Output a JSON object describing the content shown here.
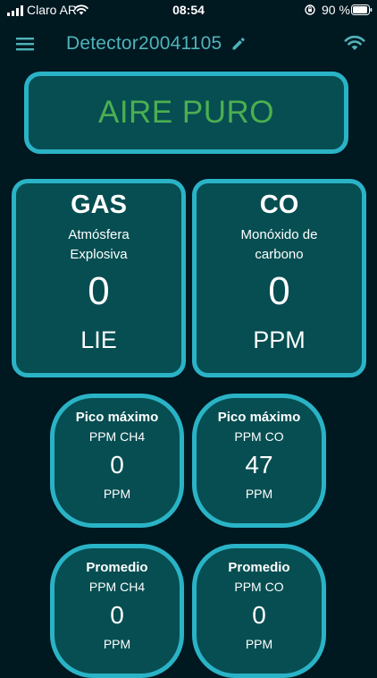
{
  "status_bar": {
    "carrier": "Claro AR",
    "time": "08:54",
    "battery": "90 %"
  },
  "header": {
    "title": "Detector20041105",
    "icons": [
      "menu-icon",
      "edit-icon",
      "wifi-icon"
    ]
  },
  "air_status": {
    "label": "AIRE PURO",
    "color": "#4caf50"
  },
  "sensors": [
    {
      "title": "GAS",
      "subtitle_line1": "Atmósfera",
      "subtitle_line2": "Explosiva",
      "value": "0",
      "unit": "LIE"
    },
    {
      "title": "CO",
      "subtitle_line1": "Monóxido de",
      "subtitle_line2": "carbono",
      "value": "0",
      "unit": "PPM"
    }
  ],
  "stats": [
    {
      "title": "Pico máximo",
      "subtitle": "PPM CH4",
      "value": "0",
      "unit": "PPM"
    },
    {
      "title": "Pico máximo",
      "subtitle": "PPM CO",
      "value": "47",
      "unit": "PPM"
    },
    {
      "title": "Promedio",
      "subtitle": "PPM CH4",
      "value": "0",
      "unit": "PPM"
    },
    {
      "title": "Promedio",
      "subtitle": "PPM CO",
      "value": "0",
      "unit": "PPM"
    }
  ],
  "colors": {
    "background": "#001820",
    "card_fill": "#064e52",
    "card_border": "#2ab3c6",
    "accent": "#4fb3bb"
  }
}
